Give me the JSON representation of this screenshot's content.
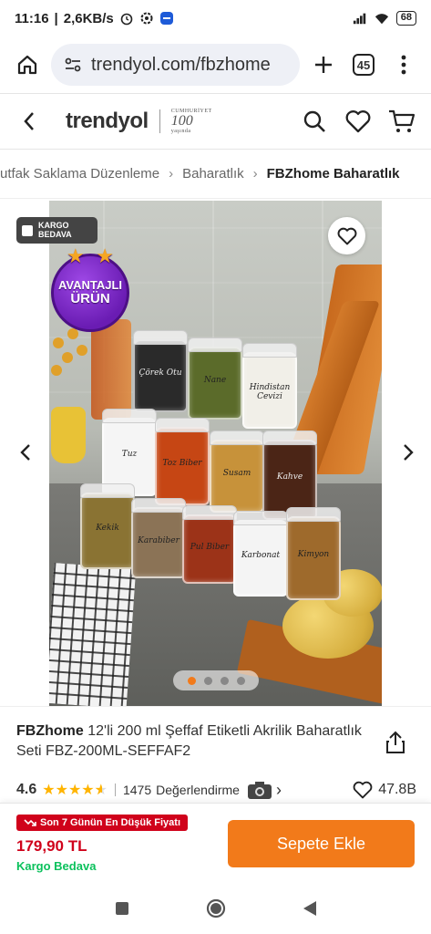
{
  "status_bar": {
    "time": "11:16",
    "speed": "2,6KB/s",
    "battery": "68"
  },
  "browser": {
    "url": "trendyol.com/fbzhomе",
    "tab_count": "45"
  },
  "site": {
    "logo": "trendyol",
    "cumhuriyet_top": "CUMHURİYET",
    "cumhuriyet_main": "100",
    "cumhuriyet_sub": "yaşında"
  },
  "breadcrumb": [
    "utfak Saklama Düzenleme",
    "Baharatlık",
    "FBZhome Baharatlık"
  ],
  "gallery": {
    "kargo_badge_line1": "KARGO",
    "kargo_badge_line2": "BEDAVA",
    "avantaj_line1": "AVANTAJLI",
    "avantaj_line2": "ÜRÜN",
    "jars": [
      {
        "label": "Çörek Otu"
      },
      {
        "label": "Nane"
      },
      {
        "label": "Hindistan Cevizi"
      },
      {
        "label": "Tuz"
      },
      {
        "label": "Toz Biber"
      },
      {
        "label": "Susam"
      },
      {
        "label": "Kahve"
      },
      {
        "label": "Kekik"
      },
      {
        "label": "Karabiber"
      },
      {
        "label": "Pul Biber"
      },
      {
        "label": "Karbonat"
      },
      {
        "label": "Kimyon"
      }
    ],
    "dots_count": 4,
    "active_dot": 1
  },
  "product": {
    "brand": "FBZhome",
    "name": "12'li 200 ml Şeffaf Etiketli Akrilik Baharatlık Seti FBZ-200ML-SEFFAF2",
    "rating": "4.6",
    "rating_value": 4.6,
    "review_count": "1475",
    "review_label": "Değerlendirme",
    "favorites": "47.8B"
  },
  "buy_bar": {
    "low_price_badge": "Son 7 Günün En Düşük Fiyatı",
    "price": "179,90 TL",
    "shipping": "Kargo Bedava",
    "add_to_cart": "Sepete Ekle"
  },
  "colors": {
    "accent": "#f27a1a",
    "price_red": "#d0021b",
    "shipping_green": "#0bc15c",
    "star": "#ffb400"
  }
}
